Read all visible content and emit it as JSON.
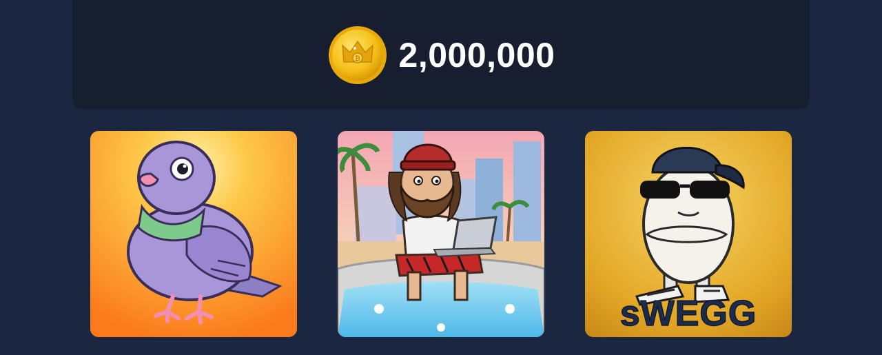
{
  "balance": {
    "amount": "2,000,000",
    "icon": "crown-coin-icon",
    "coin_color": "#f5c518"
  },
  "cards": [
    {
      "id": "pigeon",
      "icon": "pigeon-avatar",
      "bg_colors": [
        "#fde36a",
        "#fb8a1e"
      ]
    },
    {
      "id": "hobo",
      "icon": "bearded-man-laptop-avatar",
      "bg_colors": [
        "#f2a7b4",
        "#8fd0f0"
      ]
    },
    {
      "id": "swegg",
      "icon": "egg-sunglasses-avatar",
      "brand_text": "sWEGG",
      "bg_colors": [
        "#f2c64a",
        "#c98a18"
      ]
    }
  ],
  "colors": {
    "page_bg": "#1b2640",
    "panel_bg": "#171e30"
  }
}
